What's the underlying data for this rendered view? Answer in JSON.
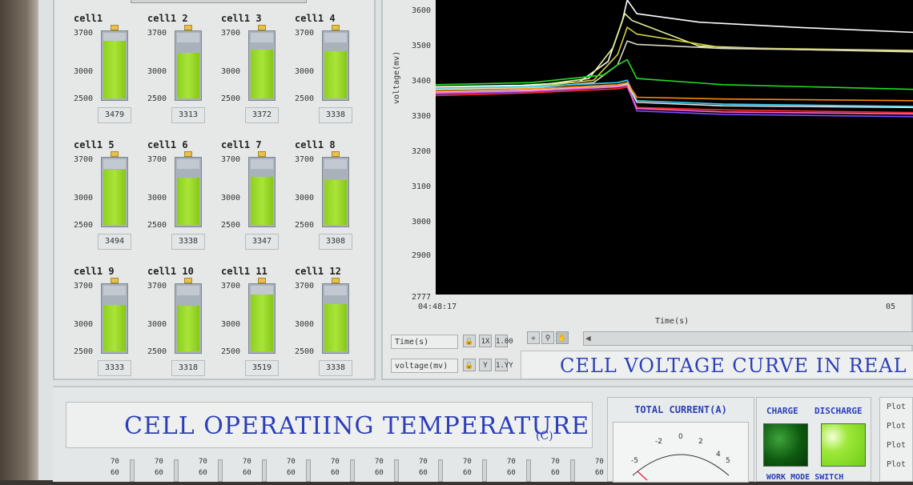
{
  "cells": [
    {
      "name": "cell1",
      "value": "3479",
      "level": 0.86
    },
    {
      "name": "cell1 2",
      "value": "3313",
      "level": 0.68
    },
    {
      "name": "cell1 3",
      "value": "3372",
      "level": 0.73
    },
    {
      "name": "cell1 4",
      "value": "3338",
      "level": 0.7
    },
    {
      "name": "cell1 5",
      "value": "3494",
      "level": 0.82
    },
    {
      "name": "cell1 6",
      "value": "3338",
      "level": 0.7
    },
    {
      "name": "cell1 7",
      "value": "3347",
      "level": 0.71
    },
    {
      "name": "cell1 8",
      "value": "3308",
      "level": 0.67
    },
    {
      "name": "cell1 9",
      "value": "3333",
      "level": 0.69
    },
    {
      "name": "cell1 10",
      "value": "3318",
      "level": 0.68
    },
    {
      "name": "cell1 11",
      "value": "3519",
      "level": 0.84
    },
    {
      "name": "cell1 12",
      "value": "3338",
      "level": 0.7
    }
  ],
  "cell_scale": {
    "top": "3700",
    "mid": "3000",
    "bottom": "2500"
  },
  "chart": {
    "title": "CELL VOLTAGE CURVE IN REAL TIME",
    "y_label": "voltage(mv)",
    "x_label": "Time(s)",
    "x_start": "04:48:17",
    "x_end": "05",
    "y_ticks": [
      "3600",
      "3500",
      "3400",
      "3300",
      "3200",
      "3100",
      "3000",
      "2900",
      "2777"
    ],
    "legend": [
      "Time(s)",
      "voltage(mv)"
    ],
    "tools": {
      "t1": "1X",
      "t2": "1.00",
      "t3": "Y",
      "t4": "1.YY"
    }
  },
  "chart_data": {
    "type": "line",
    "xlabel": "Time(s)",
    "ylabel": "voltage(mv)",
    "ylim": [
      2777,
      3640
    ],
    "x_range": [
      "04:48:17",
      "05"
    ],
    "series": [
      {
        "color": "#ffffff",
        "points": [
          [
            0,
            3386
          ],
          [
            0.18,
            3390
          ],
          [
            0.3,
            3400
          ],
          [
            0.36,
            3460
          ],
          [
            0.39,
            3580
          ],
          [
            0.4,
            3640
          ],
          [
            0.42,
            3600
          ],
          [
            0.55,
            3575
          ],
          [
            0.75,
            3560
          ],
          [
            1,
            3545
          ]
        ]
      },
      {
        "color": "#e8f2a0",
        "points": [
          [
            0,
            3383
          ],
          [
            0.2,
            3388
          ],
          [
            0.32,
            3410
          ],
          [
            0.37,
            3500
          ],
          [
            0.395,
            3600
          ],
          [
            0.41,
            3580
          ],
          [
            0.55,
            3505
          ],
          [
            0.75,
            3495
          ],
          [
            1,
            3488
          ]
        ]
      },
      {
        "color": "#cfcf40",
        "points": [
          [
            0,
            3380
          ],
          [
            0.2,
            3385
          ],
          [
            0.33,
            3405
          ],
          [
            0.38,
            3480
          ],
          [
            0.4,
            3560
          ],
          [
            0.42,
            3540
          ],
          [
            0.6,
            3500
          ],
          [
            1,
            3492
          ]
        ]
      },
      {
        "color": "#d9d9c8",
        "points": [
          [
            0,
            3378
          ],
          [
            0.2,
            3382
          ],
          [
            0.33,
            3398
          ],
          [
            0.38,
            3450
          ],
          [
            0.4,
            3520
          ],
          [
            0.42,
            3510
          ],
          [
            0.6,
            3498
          ],
          [
            1,
            3490
          ]
        ]
      },
      {
        "color": "#22dd22",
        "points": [
          [
            0,
            3392
          ],
          [
            0.2,
            3398
          ],
          [
            0.35,
            3420
          ],
          [
            0.38,
            3450
          ],
          [
            0.4,
            3465
          ],
          [
            0.42,
            3410
          ],
          [
            0.6,
            3392
          ],
          [
            1,
            3378
          ]
        ]
      },
      {
        "color": "#3ad0ff",
        "points": [
          [
            0,
            3382
          ],
          [
            0.2,
            3386
          ],
          [
            0.38,
            3398
          ],
          [
            0.4,
            3405
          ],
          [
            0.42,
            3345
          ],
          [
            0.6,
            3335
          ],
          [
            1,
            3328
          ]
        ]
      },
      {
        "color": "#ff8a00",
        "points": [
          [
            0,
            3375
          ],
          [
            0.2,
            3380
          ],
          [
            0.38,
            3392
          ],
          [
            0.4,
            3398
          ],
          [
            0.42,
            3355
          ],
          [
            0.6,
            3350
          ],
          [
            1,
            3345
          ]
        ]
      },
      {
        "color": "#ff2a2a",
        "points": [
          [
            0,
            3360
          ],
          [
            0.2,
            3368
          ],
          [
            0.38,
            3380
          ],
          [
            0.4,
            3385
          ],
          [
            0.42,
            3325
          ],
          [
            0.6,
            3318
          ],
          [
            1,
            3310
          ]
        ]
      },
      {
        "color": "#7b4cff",
        "points": [
          [
            0,
            3365
          ],
          [
            0.2,
            3372
          ],
          [
            0.38,
            3385
          ],
          [
            0.4,
            3390
          ],
          [
            0.42,
            3315
          ],
          [
            0.6,
            3305
          ],
          [
            1,
            3298
          ]
        ]
      },
      {
        "color": "#e4e4e4",
        "points": [
          [
            0,
            3370
          ],
          [
            0.2,
            3376
          ],
          [
            0.38,
            3388
          ],
          [
            0.4,
            3394
          ],
          [
            0.42,
            3340
          ],
          [
            0.6,
            3330
          ],
          [
            1,
            3325
          ]
        ]
      },
      {
        "color": "#ff66cc",
        "points": [
          [
            0,
            3368
          ],
          [
            0.2,
            3374
          ],
          [
            0.38,
            3386
          ],
          [
            0.4,
            3390
          ],
          [
            0.42,
            3322
          ],
          [
            0.6,
            3312
          ],
          [
            1,
            3306
          ]
        ]
      }
    ]
  },
  "temperature": {
    "title": "CELL OPERATIING TEMPERATURE",
    "unit": "(C)",
    "tick_top": "70",
    "tick_bottom": "60"
  },
  "current": {
    "title": "TOTAL CURRENT(A)",
    "ticks": [
      "-5",
      "-2",
      "0",
      "2",
      "5",
      "4"
    ]
  },
  "mode": {
    "charge": "CHARGE",
    "discharge": "DISCHARGE",
    "switch_label": "WORK MODE SWITCH"
  },
  "plot_list": [
    "Plot",
    "Plot",
    "Plot",
    "Plot"
  ]
}
